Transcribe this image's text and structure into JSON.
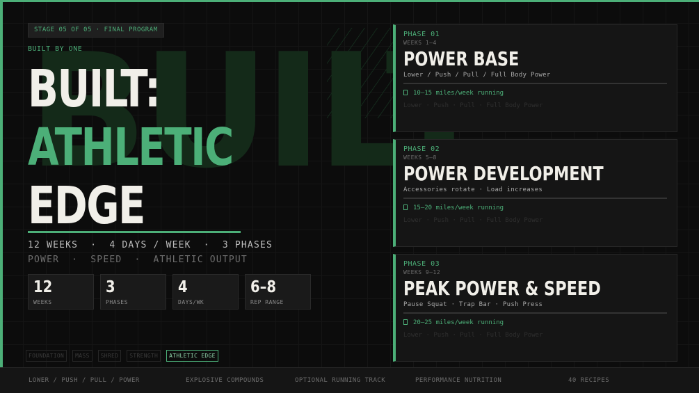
{
  "stage": {
    "label": "STAGE 05 OF 05 · FINAL PROGRAM"
  },
  "brand": {
    "built_by": "BUILT BY ONE"
  },
  "hero": {
    "ghost": "BUILT",
    "line1": "BUILT:",
    "line2": "ATHLETIC",
    "line3": "EDGE"
  },
  "meta": {
    "line1": "12 WEEKS  ·  4 DAYS / WEEK  ·  3 PHASES",
    "line2": "POWER  ·  SPEED  ·  ATHLETIC OUTPUT"
  },
  "stats": [
    {
      "value": "12",
      "label": "WEEKS"
    },
    {
      "value": "3",
      "label": "PHASES"
    },
    {
      "value": "4",
      "label": "DAYS/WK"
    },
    {
      "value": "6–8",
      "label": "REP RANGE"
    }
  ],
  "stages_nav": [
    {
      "label": "FOUNDATION",
      "active": false
    },
    {
      "label": "MASS",
      "active": false
    },
    {
      "label": "SHRED",
      "active": false
    },
    {
      "label": "STRENGTH",
      "active": false
    },
    {
      "label": "ATHLETIC EDGE",
      "active": true
    }
  ],
  "phases": [
    {
      "phase": "PHASE 01",
      "weeks": "WEEKS 1–4",
      "name": "POWER BASE",
      "split": "Lower / Push / Pull / Full Body Power",
      "running": "10–15 miles/week running",
      "days": "Lower · Push · Pull · Full Body Power"
    },
    {
      "phase": "PHASE 02",
      "weeks": "WEEKS 5–8",
      "name": "POWER DEVELOPMENT",
      "split": "Accessories rotate · Load increases",
      "running": "15–20 miles/week running",
      "days": "Lower · Push · Pull · Full Body Power"
    },
    {
      "phase": "PHASE 03",
      "weeks": "WEEKS 9–12",
      "name": "PEAK POWER & SPEED",
      "split": "Pause Squat · Trap Bar · Push Press",
      "running": "20–25 miles/week running",
      "days": "Lower · Push · Pull · Full Body Power"
    }
  ],
  "footer": {
    "items": [
      "LOWER / PUSH / PULL / POWER",
      "EXPLOSIVE COMPOUNDS",
      "OPTIONAL RUNNING TRACK",
      "PERFORMANCE NUTRITION",
      "40 RECIPES"
    ]
  },
  "colors": {
    "accent": "#4caf78",
    "background": "#0c0c0c",
    "card": "#151515"
  }
}
